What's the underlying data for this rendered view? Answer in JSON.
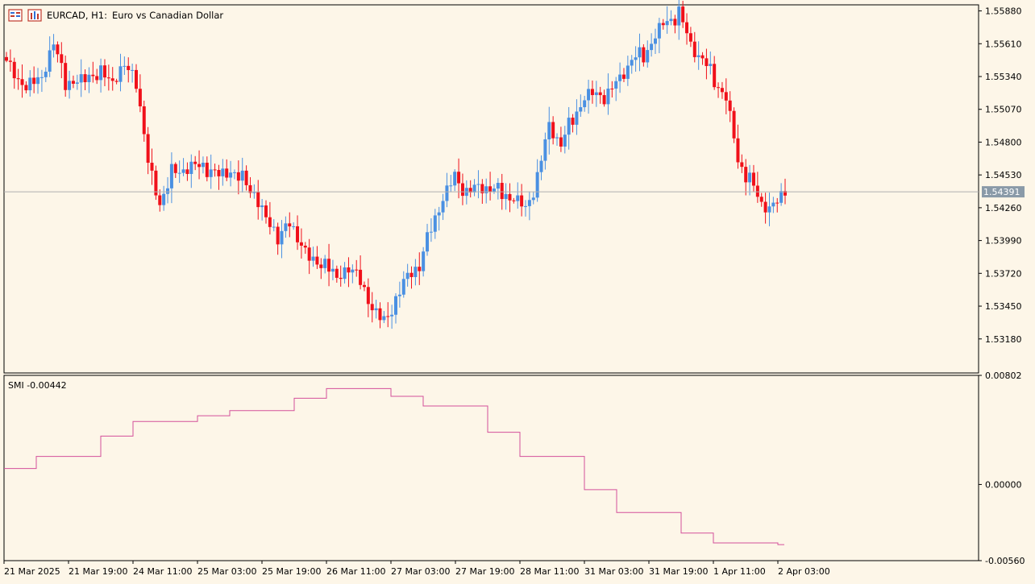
{
  "header": {
    "symbol": "EURCAD, H1:",
    "description": "Euro vs Canadian Dollar",
    "icons": [
      "window-list-icon",
      "chart-window-icon"
    ]
  },
  "colors": {
    "background": "#fdf6e8",
    "bull": "#4a90e2",
    "bear": "#f0101a",
    "smi_line": "#d4509a",
    "price_line": "#b0b0b0",
    "current_price_bg": "#8a9aa8"
  },
  "chart_data": [
    {
      "type": "candlestick",
      "timeframe": "H1",
      "y_ticks": [
        "1.55880",
        "1.55610",
        "1.55340",
        "1.55070",
        "1.54800",
        "1.54530",
        "1.54260",
        "1.53990",
        "1.53720",
        "1.53450",
        "1.53180"
      ],
      "ylim": [
        1.529,
        1.5593
      ],
      "current_price": "1.54391",
      "close_path": [
        1.5544,
        1.5531,
        1.5526,
        1.5536,
        1.5561,
        1.553,
        1.5527,
        1.5535,
        1.5536,
        1.5532,
        1.5543,
        1.5531,
        1.5462,
        1.5428,
        1.5455,
        1.5458,
        1.5462,
        1.5458,
        1.5452,
        1.5455,
        1.545,
        1.5438,
        1.5418,
        1.5402,
        1.5412,
        1.5395,
        1.538,
        1.5382,
        1.5368,
        1.5378,
        1.5365,
        1.5342,
        1.5332,
        1.535,
        1.5372,
        1.5378,
        1.541,
        1.5432,
        1.5452,
        1.5438,
        1.5445,
        1.5442,
        1.5438,
        1.5432,
        1.5425,
        1.545,
        1.5496,
        1.5478,
        1.55,
        1.5515,
        1.552,
        1.5518,
        1.5535,
        1.5548,
        1.5552,
        1.5566,
        1.558,
        1.5585,
        1.5562,
        1.5548,
        1.5532,
        1.5515,
        1.5465,
        1.5448,
        1.543,
        1.5428,
        1.5436
      ]
    },
    {
      "type": "line",
      "name": "SMI",
      "label": "SMI -0.00442",
      "y_ticks": [
        "0.00802",
        "0.00000",
        "-0.00560"
      ],
      "ylim": [
        -0.0056,
        0.00802
      ],
      "steps": [
        {
          "start": 0,
          "value": 0.00117
        },
        {
          "start": 1,
          "value": 0.00206
        },
        {
          "start": 3,
          "value": 0.00356
        },
        {
          "start": 4,
          "value": 0.00463
        },
        {
          "start": 6,
          "value": 0.00505
        },
        {
          "start": 7,
          "value": 0.00543
        },
        {
          "start": 9,
          "value": 0.00634
        },
        {
          "start": 10,
          "value": 0.00705
        },
        {
          "start": 12,
          "value": 0.00648
        },
        {
          "start": 13,
          "value": 0.00577
        },
        {
          "start": 15,
          "value": 0.00384
        },
        {
          "start": 16,
          "value": 0.00206
        },
        {
          "start": 18,
          "value": -0.00038
        },
        {
          "start": 19,
          "value": -0.00206
        },
        {
          "start": 21,
          "value": -0.00357
        },
        {
          "start": 22,
          "value": -0.0043
        },
        {
          "start": 24,
          "value": -0.00442
        }
      ],
      "end": 24.2
    }
  ],
  "x_ticks": [
    "21 Mar 2025",
    "21 Mar 19:00",
    "24 Mar 11:00",
    "25 Mar 03:00",
    "25 Mar 19:00",
    "26 Mar 11:00",
    "27 Mar 03:00",
    "27 Mar 19:00",
    "28 Mar 11:00",
    "31 Mar 03:00",
    "31 Mar 19:00",
    "1 Apr 11:00",
    "2 Apr 03:00"
  ]
}
